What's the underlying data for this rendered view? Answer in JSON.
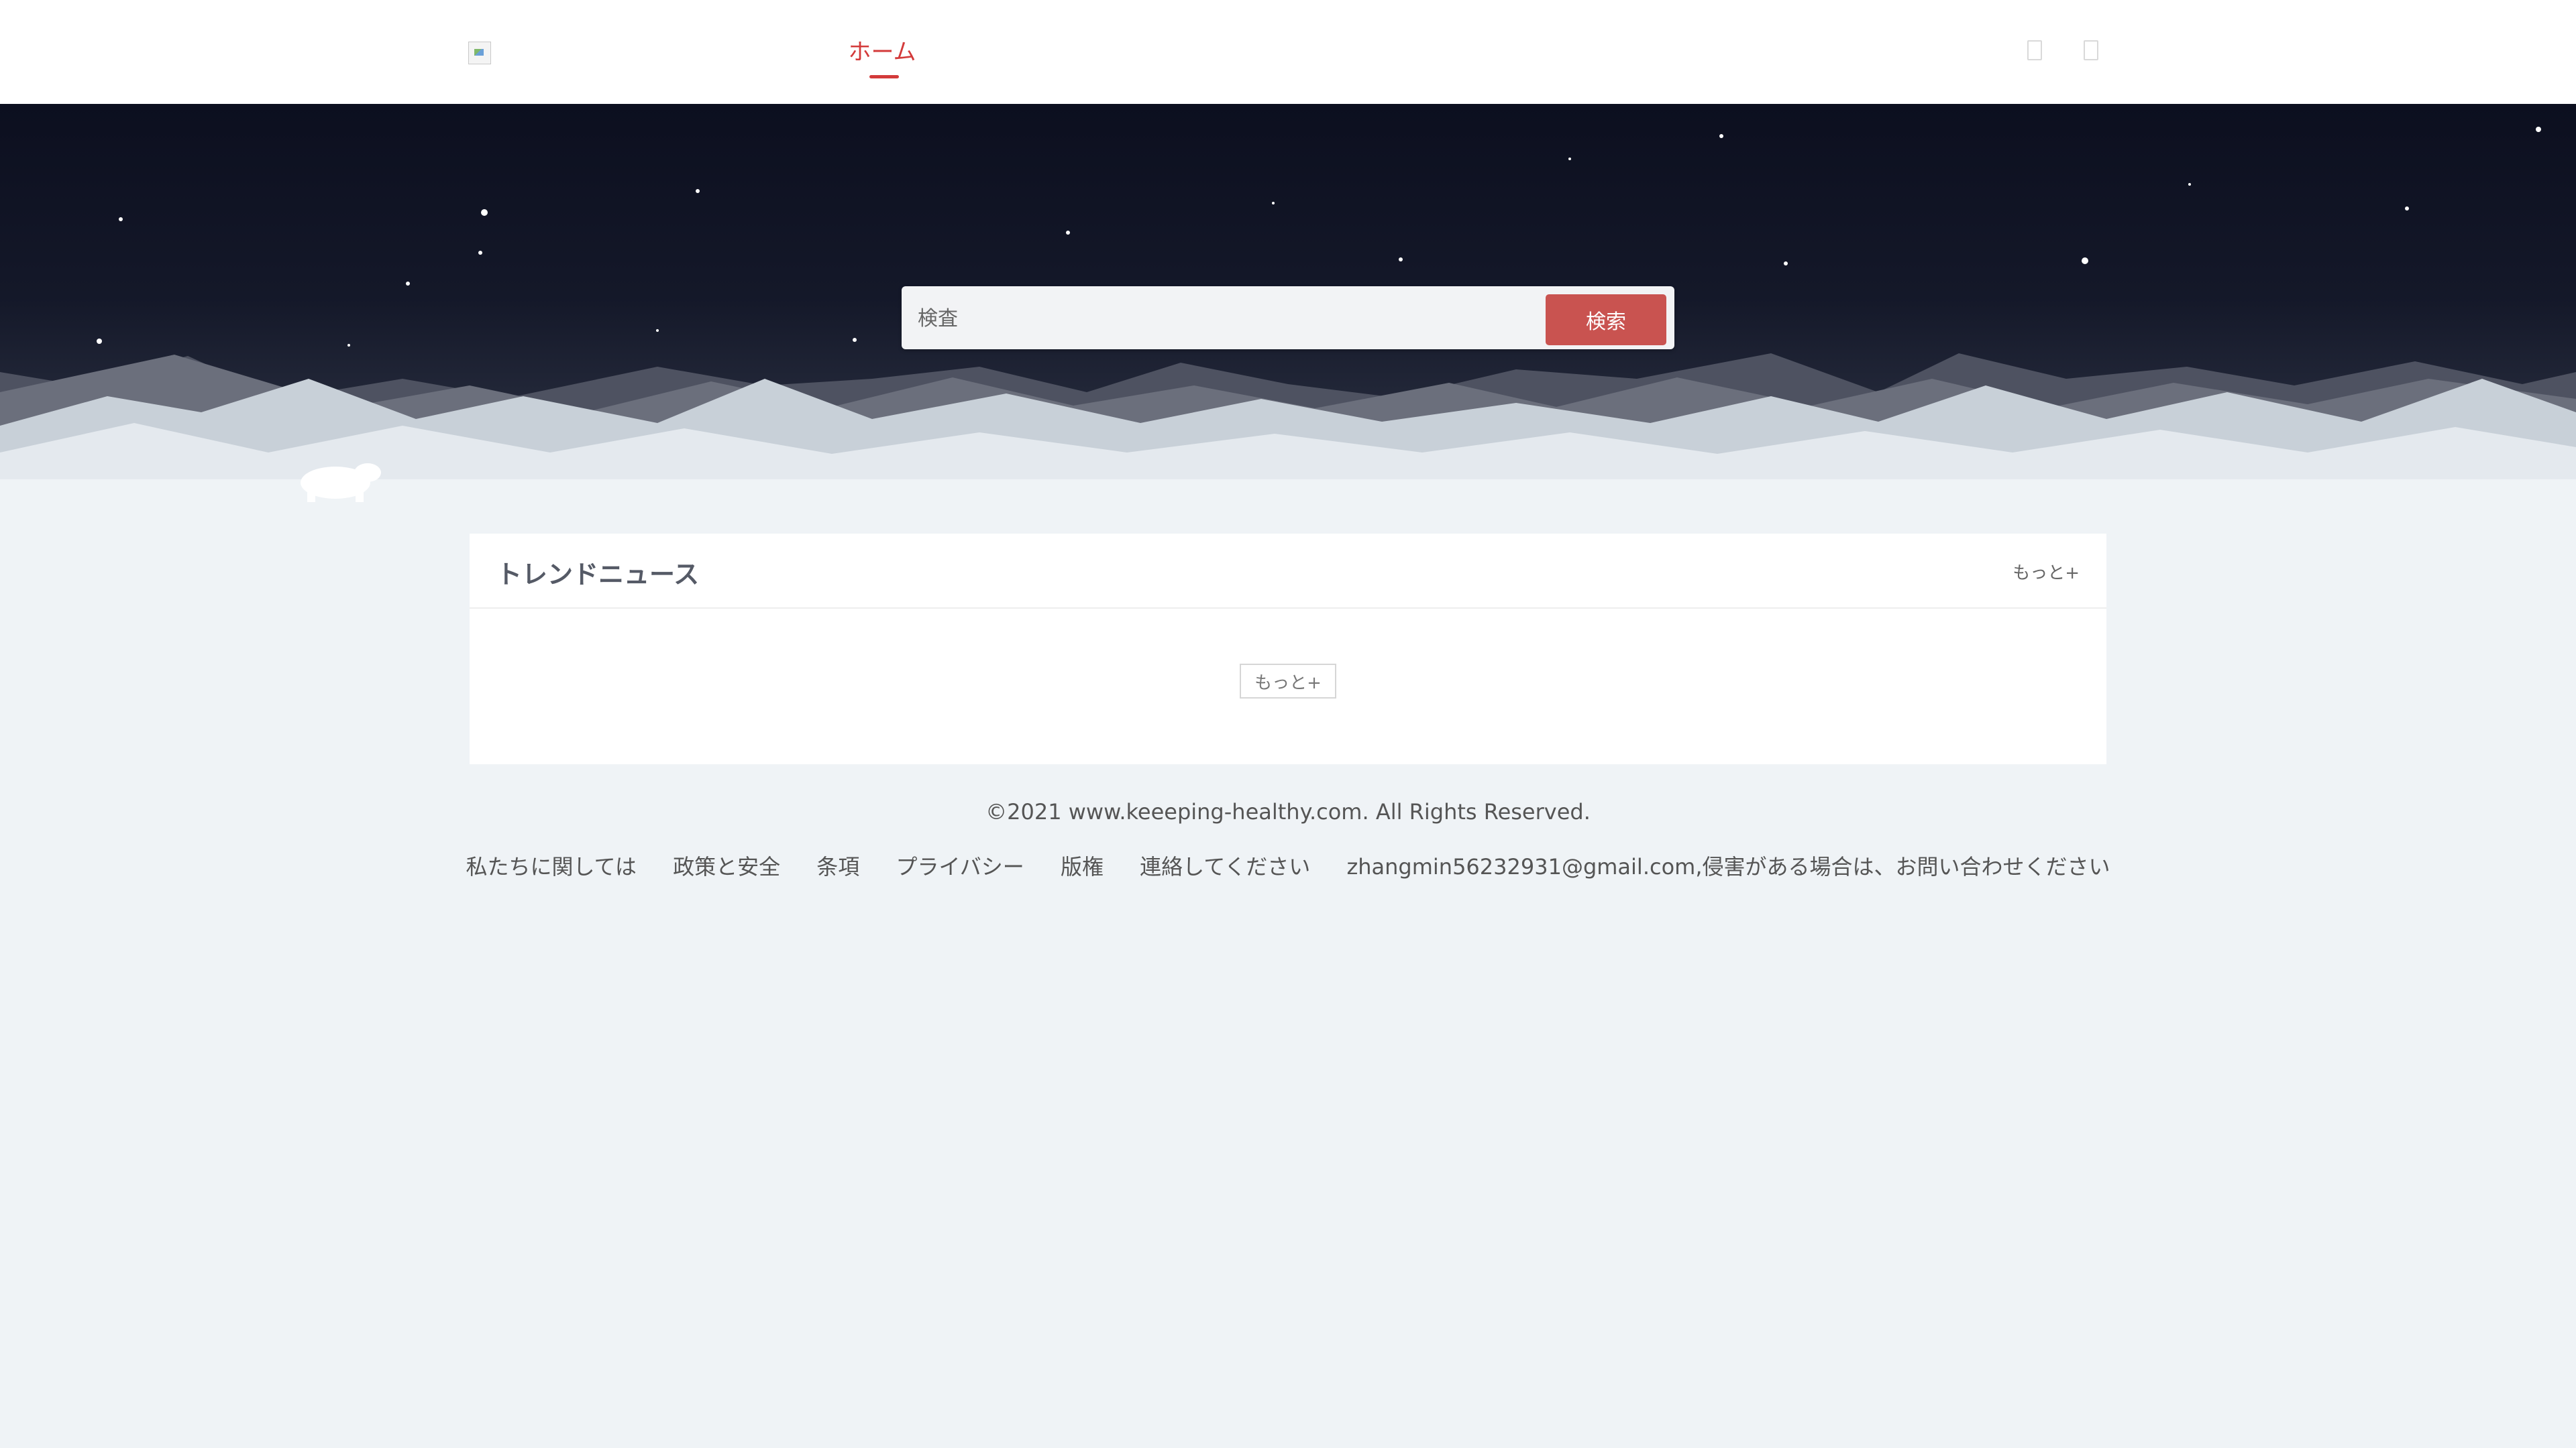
{
  "header": {
    "nav": {
      "home_label": "ホーム"
    },
    "accent_color": "#d33a3a"
  },
  "hero": {
    "search": {
      "placeholder": "検査",
      "button_label": "検索"
    },
    "search_button_color": "#c95350"
  },
  "news": {
    "title": "トレンドニュース",
    "more_link": "もっと+",
    "more_button": "もっと+"
  },
  "footer": {
    "copyright": "©2021 www.keeeping-healthy.com. All Rights Reserved.",
    "links": [
      "私たちに関しては",
      "政策と安全",
      "条項",
      "プライバシー",
      "版権",
      "連絡してください"
    ],
    "contact_text": "zhangmin56232931@gmail.com,侵害がある場合は、お問い合わせください"
  }
}
